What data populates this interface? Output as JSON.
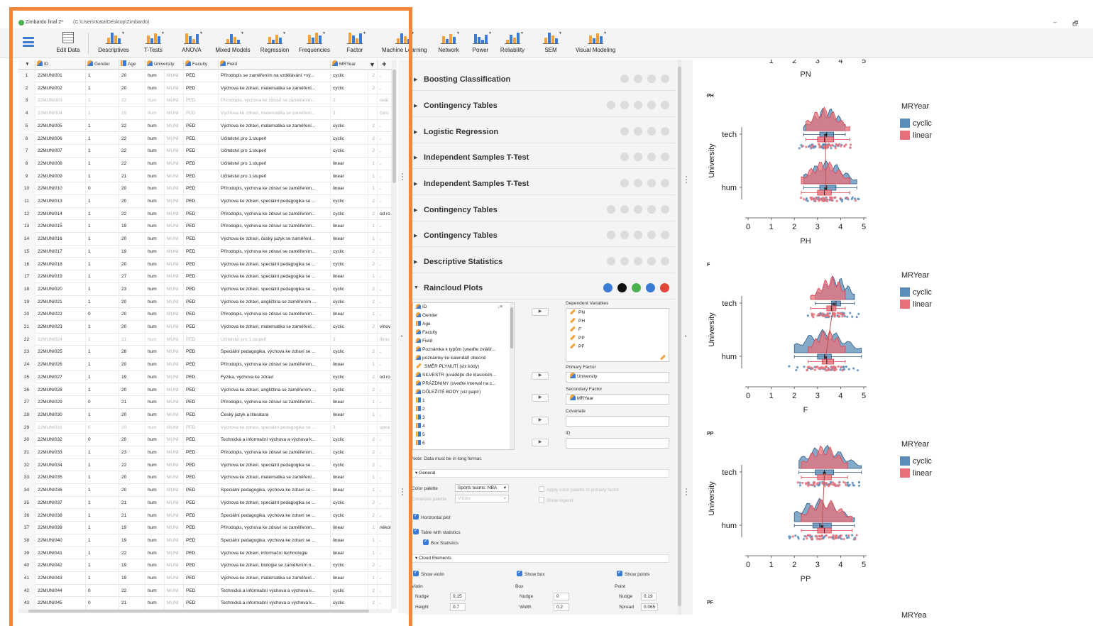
{
  "window": {
    "title": "Zimbardo final 2*",
    "path": "(C:\\Users\\Kata\\Desktop\\Zimbardo)",
    "minimize": "–",
    "restore": "🗗"
  },
  "ribbon": {
    "items": [
      "Edit Data",
      "Descriptives",
      "T-Tests",
      "ANOVA",
      "Mixed Models",
      "Regression",
      "Frequencies",
      "Factor",
      "Machine Learning",
      "Network",
      "Power",
      "Reliability",
      "SEM",
      "Visual Modeling"
    ]
  },
  "grid": {
    "headers": [
      "ID",
      "Gender",
      "Age",
      "University",
      "Faculty",
      "Field",
      "MRYear"
    ],
    "rows": [
      {
        "n": "1",
        "id": "22MUNI001",
        "g": "1",
        "a": "20",
        "u": "hum",
        "f": "MUNI",
        "fa": "PED",
        "fd": "Přírodopis se zaměřením na vzdělávání +vý...",
        "m": "cyclic",
        "l": "2",
        "x": "."
      },
      {
        "n": "2",
        "id": "22MUNI002",
        "g": "1",
        "a": "20",
        "u": "hum",
        "f": "MUNI",
        "fa": "PED",
        "fd": "Výchova ke zdraví, matematika se zaměření...",
        "m": "cyclic",
        "l": "2",
        "x": "."
      },
      {
        "n": "3",
        "id": "22MUNI003",
        "g": "1",
        "a": "22",
        "u": "hum",
        "f": "MUNI",
        "fa": "PED",
        "fd": "Přírodopis, výchova ke zdraví se zaměřením...",
        "m": "3",
        "l": "",
        "x": "ovál",
        "dim": true
      },
      {
        "n": "4",
        "id": "22MUNI004",
        "g": "1",
        "a": "19",
        "u": "hum",
        "f": "MUNI",
        "fa": "PED",
        "fd": "Výchova ke zdraví, matematika se zaměření...",
        "m": "3",
        "l": "",
        "x": "čáro",
        "dim": true
      },
      {
        "n": "5",
        "id": "22MUNI005",
        "g": "1",
        "a": "22",
        "u": "hum",
        "f": "MUNI",
        "fa": "PED",
        "fd": "Výchova ke zdraví, matematika se zaměření...",
        "m": "cyclic",
        "l": "2",
        "x": "."
      },
      {
        "n": "6",
        "id": "22MUNI006",
        "g": "1",
        "a": "22",
        "u": "hum",
        "f": "MUNI",
        "fa": "PED",
        "fd": "Učitelství pro 1.stupeň",
        "m": "cyclic",
        "l": "2",
        "x": "."
      },
      {
        "n": "7",
        "id": "22MUNI007",
        "g": "1",
        "a": "22",
        "u": "hum",
        "f": "MUNI",
        "fa": "PED",
        "fd": "Učitelství pro 1.stupeň",
        "m": "cyclic",
        "l": "2",
        "x": "."
      },
      {
        "n": "8",
        "id": "22MUNI008",
        "g": "1",
        "a": "22",
        "u": "hum",
        "f": "MUNI",
        "fa": "PED",
        "fd": "Učitelství pro 1.stupeň",
        "m": "linear",
        "l": "1",
        "x": "."
      },
      {
        "n": "9",
        "id": "22MUNI009",
        "g": "1",
        "a": "21",
        "u": "hum",
        "f": "MUNI",
        "fa": "PED",
        "fd": "Učitelství pro 1.stupeň",
        "m": "linear",
        "l": "1",
        "x": "."
      },
      {
        "n": "10",
        "id": "22MUNI010",
        "g": "0",
        "a": "20",
        "u": "hum",
        "f": "MUNI",
        "fa": "PED",
        "fd": "Přírodopis, výchova ke zdraví se zaměřením...",
        "m": "linear",
        "l": "1",
        "x": "."
      },
      {
        "n": "11",
        "id": "22MUNI013",
        "g": "1",
        "a": "20",
        "u": "hum",
        "f": "MUNI",
        "fa": "PED",
        "fd": "Výchova ke zdraví, speciální pedagogika se ...",
        "m": "cyclic",
        "l": "2",
        "x": "."
      },
      {
        "n": "12",
        "id": "22MUNI014",
        "g": "1",
        "a": "22",
        "u": "hum",
        "f": "MUNI",
        "fa": "PED",
        "fd": "Přírodopis, výchova ke zdraví se zaměřením...",
        "m": "cyclic",
        "l": "2",
        "x": "od ro"
      },
      {
        "n": "13",
        "id": "22MUNI015",
        "g": "1",
        "a": "19",
        "u": "hum",
        "f": "MUNI",
        "fa": "PED",
        "fd": "Přírodopis, výchova ke zdraví se zaměřením...",
        "m": "linear",
        "l": "1",
        "x": "."
      },
      {
        "n": "14",
        "id": "22MUNI016",
        "g": "1",
        "a": "20",
        "u": "hum",
        "f": "MUNI",
        "fa": "PED",
        "fd": "Výchova ke zdraví, český jazyk se zaměření...",
        "m": "linear",
        "l": "1",
        "x": "."
      },
      {
        "n": "15",
        "id": "22MUNI017",
        "g": "1",
        "a": "19",
        "u": "hum",
        "f": "MUNI",
        "fa": "PED",
        "fd": "Přírodopis, výchova ke zdraví se zaměřením...",
        "m": "cyclic",
        "l": "2",
        "x": "."
      },
      {
        "n": "16",
        "id": "22MUNI018",
        "g": "1",
        "a": "20",
        "u": "hum",
        "f": "MUNI",
        "fa": "PED",
        "fd": "Výchova ke zdraví, speciální pedagogika se ...",
        "m": "cyclic",
        "l": "2",
        "x": "."
      },
      {
        "n": "17",
        "id": "22MUNI019",
        "g": "1",
        "a": "27",
        "u": "hum",
        "f": "MUNI",
        "fa": "PED",
        "fd": "Výchova ke zdraví, speciální pedagogika se ...",
        "m": "linear",
        "l": "1",
        "x": "."
      },
      {
        "n": "18",
        "id": "22MUNI020",
        "g": "1",
        "a": "23",
        "u": "hum",
        "f": "MUNI",
        "fa": "PED",
        "fd": "Výchova ke zdraví, speciální pedagogika se ...",
        "m": "cyclic",
        "l": "2",
        "x": "."
      },
      {
        "n": "19",
        "id": "22MUNI021",
        "g": "1",
        "a": "20",
        "u": "hum",
        "f": "MUNI",
        "fa": "PED",
        "fd": "Výchova ke zdraví, angličtina se zaměřením ...",
        "m": "cyclic",
        "l": "2",
        "x": "."
      },
      {
        "n": "20",
        "id": "22MUNI022",
        "g": "0",
        "a": "20",
        "u": "hum",
        "f": "MUNI",
        "fa": "PED",
        "fd": "Přírodopis, výchova ke zdraví se zaměřením...",
        "m": "linear",
        "l": "1",
        "x": "."
      },
      {
        "n": "21",
        "id": "22MUNI023",
        "g": "1",
        "a": "20",
        "u": "hum",
        "f": "MUNI",
        "fa": "PED",
        "fd": "Výchova ke zdraví, matematika se zaměření...",
        "m": "cyclic",
        "l": "2",
        "x": "vlnov"
      },
      {
        "n": "22",
        "id": "22MUNI024",
        "g": "1",
        "a": "21",
        "u": "hum",
        "f": "MUNI",
        "fa": "PED",
        "fd": "Učitelství pro 1.stupeň",
        "m": "3",
        "l": "",
        "x": "filmo",
        "dim": true
      },
      {
        "n": "23",
        "id": "22MUNI025",
        "g": "1",
        "a": "28",
        "u": "hum",
        "f": "MUNI",
        "fa": "PED",
        "fd": "Speciální pedagogika, výchova ke zdraví se ...",
        "m": "cyclic",
        "l": "2",
        "x": "."
      },
      {
        "n": "24",
        "id": "22MUNI026",
        "g": "1",
        "a": "20",
        "u": "hum",
        "f": "MUNI",
        "fa": "PED",
        "fd": "Přírodopis, výchova ke zdraví se zaměřením...",
        "m": "linear",
        "l": "1",
        "x": "."
      },
      {
        "n": "25",
        "id": "22MUNI027",
        "g": "1",
        "a": "19",
        "u": "hum",
        "f": "MUNI",
        "fa": "PED",
        "fd": "Fyzika, výchova ke zdraví",
        "m": "cyclic",
        "l": "2",
        "x": "od ro"
      },
      {
        "n": "26",
        "id": "22MUNI028",
        "g": "1",
        "a": "20",
        "u": "hum",
        "f": "MUNI",
        "fa": "PED",
        "fd": "Výchova ke zdraví, angličtina se zaměřením ...",
        "m": "cyclic",
        "l": "2",
        "x": "."
      },
      {
        "n": "27",
        "id": "22MUNI029",
        "g": "0",
        "a": "21",
        "u": "hum",
        "f": "MUNI",
        "fa": "PED",
        "fd": "Přírodopis, výchova ke zdraví se zaměřením...",
        "m": "linear",
        "l": "1",
        "x": "."
      },
      {
        "n": "28",
        "id": "22MUNI030",
        "g": "1",
        "a": "20",
        "u": "hum",
        "f": "MUNI",
        "fa": "PED",
        "fd": "Český jazyk a literatura",
        "m": "linear",
        "l": "1",
        "x": "."
      },
      {
        "n": "29",
        "id": "22MUNI031",
        "g": "0",
        "a": "20",
        "u": "hum",
        "f": "MUNI",
        "fa": "PED",
        "fd": "Výchova ke zdraví, speciální pedagogika se ...",
        "m": "3",
        "l": "",
        "x": "spirá",
        "dim": true
      },
      {
        "n": "30",
        "id": "22MUNI032",
        "g": "0",
        "a": "20",
        "u": "hum",
        "f": "MUNI",
        "fa": "PED",
        "fd": "Technická a informační výchova a výchova k...",
        "m": "cyclic",
        "l": "2",
        "x": "."
      },
      {
        "n": "31",
        "id": "22MUNI033",
        "g": "1",
        "a": "23",
        "u": "hum",
        "f": "MUNI",
        "fa": "PED",
        "fd": "Přírodopis, výchova ke zdraví se zaměřením...",
        "m": "cyclic",
        "l": "2",
        "x": "."
      },
      {
        "n": "32",
        "id": "22MUNI034",
        "g": "1",
        "a": "22",
        "u": "hum",
        "f": "MUNI",
        "fa": "PED",
        "fd": "Výchova ke zdraví, speciální pedagogika se ...",
        "m": "cyclic",
        "l": "2",
        "x": "."
      },
      {
        "n": "33",
        "id": "22MUNI035",
        "g": "1",
        "a": "20",
        "u": "hum",
        "f": "MUNI",
        "fa": "PED",
        "fd": "Výchova ke zdraví, matematika se zaměření...",
        "m": "linear",
        "l": "1",
        "x": "."
      },
      {
        "n": "34",
        "id": "22MUNI036",
        "g": "1",
        "a": "20",
        "u": "hum",
        "f": "MUNI",
        "fa": "PED",
        "fd": "Speciální pedagogika, výchova ke zdraví se ...",
        "m": "linear",
        "l": "1",
        "x": "."
      },
      {
        "n": "35",
        "id": "22MUNI037",
        "g": "1",
        "a": "21",
        "u": "hum",
        "f": "MUNI",
        "fa": "PED",
        "fd": "Výchova ke zdraví, speciální pedagogika se ...",
        "m": "cyclic",
        "l": "2",
        "x": "."
      },
      {
        "n": "36",
        "id": "22MUNI038",
        "g": "1",
        "a": "21",
        "u": "hum",
        "f": "MUNI",
        "fa": "PED",
        "fd": "Speciální pedagogika, výchova ke zdraví se ...",
        "m": "cyclic",
        "l": "2",
        "x": "."
      },
      {
        "n": "37",
        "id": "22MUNI039",
        "g": "1",
        "a": "19",
        "u": "hum",
        "f": "MUNI",
        "fa": "PED",
        "fd": "Přírodopis, výchova ke zdraví se zaměřením...",
        "m": "linear",
        "l": "1",
        "x": "někol"
      },
      {
        "n": "38",
        "id": "22MUNI040",
        "g": "1",
        "a": "19",
        "u": "hum",
        "f": "MUNI",
        "fa": "PED",
        "fd": "Speciální pedagogika, výchova ke zdraví se ...",
        "m": "linear",
        "l": "1",
        "x": "."
      },
      {
        "n": "39",
        "id": "22MUNI041",
        "g": "1",
        "a": "22",
        "u": "hum",
        "f": "MUNI",
        "fa": "PED",
        "fd": "Výchova ke zdraví, informační technologie",
        "m": "linear",
        "l": "1",
        "x": "."
      },
      {
        "n": "40",
        "id": "22MUNI042",
        "g": "1",
        "a": "19",
        "u": "hum",
        "f": "MUNI",
        "fa": "PED",
        "fd": "Výchova ke zdraví, biologie se zaměřením n...",
        "m": "cyclic",
        "l": "2",
        "x": "."
      },
      {
        "n": "41",
        "id": "22MUNI043",
        "g": "1",
        "a": "19",
        "u": "hum",
        "f": "MUNI",
        "fa": "PED",
        "fd": "Výchova ke zdraví, matematika se zaměření...",
        "m": "linear",
        "l": "1",
        "x": "."
      },
      {
        "n": "42",
        "id": "22MUNI044",
        "g": "0",
        "a": "22",
        "u": "hum",
        "f": "MUNI",
        "fa": "PED",
        "fd": "Technická a informační výchova a výchova k...",
        "m": "cyclic",
        "l": "2",
        "x": "."
      },
      {
        "n": "43",
        "id": "22MUNI045",
        "g": "0",
        "a": "21",
        "u": "hum",
        "f": "MUNI",
        "fa": "PED",
        "fd": "Technická a informační výchova a výchova k...",
        "m": "cyclic",
        "l": "2",
        "x": "."
      }
    ]
  },
  "analyses": {
    "sections": [
      "Boosting Classification",
      "Contingency Tables",
      "Logistic Regression",
      "Independent Samples T-Test",
      "Independent Samples T-Test",
      "Contingency Tables",
      "Contingency Tables",
      "Descriptive Statistics",
      "Raincloud Plots"
    ],
    "raincloud": {
      "variables": [
        "ID",
        "Gender",
        "Age",
        "Faculty",
        "Field",
        "Poznámka k typům (uveďte zvlášť...",
        "poznámky ke kalendáři obecně",
        "SMĚR PLYNUTÍ (viz kódy)",
        "SILVESTR (uvádějte dle klasickéh...",
        "PRÁZDNINY (uveďte interval na c...",
        "DŮLEŽITÉ BODY (viz papír)",
        "1",
        "2",
        "3",
        "4",
        "5",
        "6"
      ],
      "var_types": [
        "nom",
        "nom",
        "ord",
        "nom",
        "nom",
        "nom",
        "nom",
        "pen",
        "nom",
        "nom",
        "nom",
        "ord",
        "ord",
        "ord",
        "ord",
        "ord",
        "ord"
      ],
      "sort_icon": "↓≡",
      "dependent_label": "Dependent Variables",
      "dependent": [
        "PN",
        "PH",
        "F",
        "PP",
        "PF"
      ],
      "primary_label": "Primary Factor",
      "primary": "University",
      "secondary_label": "Secondary Factor",
      "secondary": "MRYear",
      "covariate_label": "Covariate",
      "id_label": "ID",
      "note": "Note: Data must be in long format.",
      "general": "General",
      "color_palette_label": "Color palette",
      "color_palette": "Sports teams: NBA",
      "covariate_palette_label": "Covariate palette",
      "covariate_palette": "Viridis",
      "apply_palette": "Apply color palette to primary factor",
      "show_legend": "Show legend",
      "horizontal_plot": "Horizontal plot",
      "table_stats": "Table with statistics",
      "box_stats": "Box Statistics",
      "cloud_elements": "Cloud Elements",
      "show_violin": "Show violin",
      "show_box": "Show box",
      "show_points": "Show points",
      "violin_label": "Violin",
      "box_label": "Box",
      "point_label": "Point",
      "nudge_label": "Nudge",
      "height_label": "Height",
      "width_label": "Width",
      "spread_label": "Spread",
      "violin_nudge": "0.15",
      "violin_height": "0.7",
      "box_nudge": "0",
      "box_width": "0.2",
      "point_nudge": "0.19",
      "point_spread": "0.065"
    }
  },
  "results": {
    "top_axis_label": "PN",
    "top_tick_values": [
      1,
      2,
      3,
      4,
      5
    ],
    "legend_title": "MRYear",
    "legend_items": [
      "cyclic",
      "linear"
    ],
    "colors": {
      "cyclic": "#5b8db8",
      "linear": "#e8707a",
      "cyclic_dark": "#2d5a86",
      "linear_dark": "#d8434f"
    },
    "x_ticks": [
      0,
      1,
      2,
      3,
      4,
      5
    ],
    "ylabel": "University",
    "groups": [
      "tech",
      "hum"
    ],
    "plots": [
      {
        "title": "PH",
        "xlabel": "PH"
      },
      {
        "title": "F",
        "xlabel": "F"
      },
      {
        "title": "PP",
        "xlabel": "PP"
      }
    ],
    "next_title": "PF",
    "next_legend_fragment": "MRYea"
  },
  "chart_data": [
    {
      "type": "raincloud",
      "title": "PH",
      "xlabel": "PH",
      "ylabel": "University",
      "xlim": [
        0,
        5
      ],
      "categories": [
        "tech",
        "hum"
      ],
      "series": [
        {
          "name": "cyclic",
          "median": [
            3.4,
            3.4
          ],
          "q1": [
            3.1,
            3.1
          ],
          "q3": [
            3.7,
            3.8
          ],
          "min": [
            2.4,
            2.4
          ],
          "max": [
            4.2,
            4.7
          ]
        },
        {
          "name": "linear",
          "median": [
            3.3,
            3.3
          ],
          "q1": [
            3.0,
            3.0
          ],
          "q3": [
            3.7,
            3.6
          ],
          "min": [
            2.5,
            2.3
          ],
          "max": [
            4.4,
            4.4
          ]
        }
      ]
    },
    {
      "type": "raincloud",
      "title": "F",
      "xlabel": "F",
      "ylabel": "University",
      "xlim": [
        0,
        5
      ],
      "categories": [
        "tech",
        "hum"
      ],
      "series": [
        {
          "name": "cyclic",
          "median": [
            3.8,
            3.3
          ],
          "q1": [
            3.6,
            3.0
          ],
          "q3": [
            4.0,
            3.6
          ],
          "min": [
            2.9,
            2.0
          ],
          "max": [
            4.6,
            4.9
          ]
        },
        {
          "name": "linear",
          "median": [
            3.6,
            3.4
          ],
          "q1": [
            3.4,
            3.2
          ],
          "q3": [
            3.8,
            3.7
          ],
          "min": [
            2.7,
            2.6
          ],
          "max": [
            4.2,
            4.2
          ]
        }
      ]
    },
    {
      "type": "raincloud",
      "title": "PP",
      "xlabel": "PP",
      "ylabel": "University",
      "xlim": [
        0,
        5
      ],
      "categories": [
        "tech",
        "hum"
      ],
      "series": [
        {
          "name": "cyclic",
          "median": [
            3.3,
            3.1
          ],
          "q1": [
            2.9,
            2.8
          ],
          "q3": [
            3.7,
            3.6
          ],
          "min": [
            2.2,
            2.0
          ],
          "max": [
            4.9,
            4.6
          ]
        },
        {
          "name": "linear",
          "median": [
            3.3,
            3.3
          ],
          "q1": [
            3.0,
            3.0
          ],
          "q3": [
            3.6,
            3.6
          ],
          "min": [
            2.3,
            2.3
          ],
          "max": [
            4.3,
            4.5
          ]
        }
      ]
    }
  ]
}
